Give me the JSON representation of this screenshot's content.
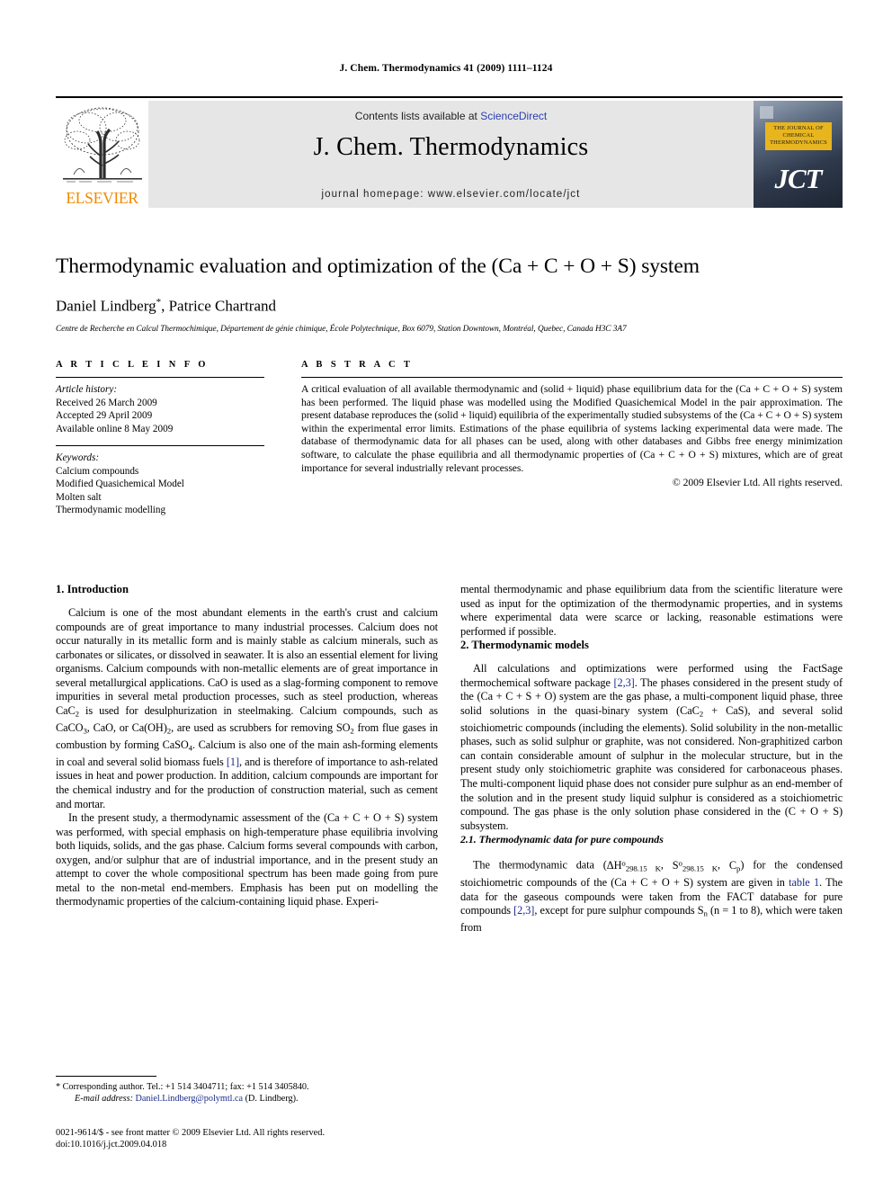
{
  "running_head": "J. Chem. Thermodynamics 41 (2009) 1111–1124",
  "masthead": {
    "publisher_name": "ELSEVIER",
    "contents_prefix": "Contents lists available at ",
    "contents_link": "ScienceDirect",
    "journal_title": "J. Chem. Thermodynamics",
    "homepage": "journal homepage: www.elsevier.com/locate/jct",
    "cover_title": "THE JOURNAL OF CHEMICAL THERMODYNAMICS",
    "cover_abbrev": "JCT"
  },
  "article": {
    "title": "Thermodynamic evaluation and optimization of the (Ca + C + O + S) system",
    "authors": "Daniel Lindberg",
    "authors_rest": ", Patrice Chartrand",
    "corresponding_marker": "*",
    "affiliation": "Centre de Recherche en Calcul Thermochimique, Département de génie chimique, École Polytechnique, Box 6079, Station Downtown, Montréal, Quebec, Canada H3C 3A7"
  },
  "info": {
    "heading": "A R T I C L E   I N F O",
    "history_label": "Article history:",
    "history": [
      "Received 26 March 2009",
      "Accepted 29 April 2009",
      "Available online 8 May 2009"
    ],
    "keywords_label": "Keywords:",
    "keywords": [
      "Calcium compounds",
      "Modified Quasichemical Model",
      "Molten salt",
      "Thermodynamic modelling"
    ]
  },
  "abstract": {
    "heading": "A B S T R A C T",
    "text": "A critical evaluation of all available thermodynamic and (solid + liquid) phase equilibrium data for the (Ca + C + O + S) system has been performed. The liquid phase was modelled using the Modified Quasichemical Model in the pair approximation. The present database reproduces the (solid + liquid) equilibria of the experimentally studied subsystems of the (Ca + C + O + S) system within the experimental error limits. Estimations of the phase equilibria of systems lacking experimental data were made. The database of thermodynamic data for all phases can be used, along with other databases and Gibbs free energy minimization software, to calculate the phase equilibria and all thermodynamic properties of (Ca + C + O + S) mixtures, which are of great importance for several industrially relevant processes.",
    "copyright": "© 2009 Elsevier Ltd. All rights reserved."
  },
  "sections": {
    "intro_heading": "1. Introduction",
    "intro_p1_a": "Calcium is one of the most abundant elements in the earth's crust and calcium compounds are of great importance to many industrial processes. Calcium does not occur naturally in its metallic form and is mainly stable as calcium minerals, such as carbonates or silicates, or dissolved in seawater. It is also an essential element for living organisms. Calcium compounds with non-metallic elements are of great importance in several metallurgical applications. CaO is used as a slag-forming component to remove impurities in several metal production processes, such as steel production, whereas CaC",
    "intro_p1_b": " is used for desulphurization in steelmaking. Calcium compounds, such as CaCO",
    "intro_p1_c": ", CaO, or Ca(OH)",
    "intro_p1_d": ", are used as scrubbers for removing SO",
    "intro_p1_e": " from flue gases in combustion by forming CaSO",
    "intro_p1_f": ". Calcium is also one of the main ash-forming elements in coal and several solid biomass fuels ",
    "intro_p1_ref": "[1]",
    "intro_p1_g": ", and is therefore of importance to ash-related issues in heat and power production. In addition, calcium compounds are important for the chemical industry and for the production of construction material, such as cement and mortar.",
    "intro_p2": "In the present study, a thermodynamic assessment of the (Ca + C + O + S) system was performed, with special emphasis on high-temperature phase equilibria involving both liquids, solids, and the gas phase. Calcium forms several compounds with carbon, oxygen, and/or sulphur that are of industrial importance, and in the present study an attempt to cover the whole compositional spectrum has been made going from pure metal to the non-metal end-members. Emphasis has been put on modelling the thermodynamic properties of the calcium-containing liquid phase. Experi-",
    "intro_p2_cont": "mental thermodynamic and phase equilibrium data from the scientific literature were used as input for the optimization of the thermodynamic properties, and in systems where experimental data were scarce or lacking, reasonable estimations were performed if possible.",
    "models_heading": "2. Thermodynamic models",
    "models_p1_a": "All calculations and optimizations were performed using the FactSage thermochemical software package ",
    "models_p1_ref": "[2,3]",
    "models_p1_b": ". The phases considered in the present study of the (Ca + C + S + O) system are the gas phase, a multi-component liquid phase, three solid solutions in the quasi-binary system (CaC",
    "models_p1_c": " + CaS), and several solid stoichiometric compounds (including the elements). Solid solubility in the non-metallic phases, such as solid sulphur or graphite, was not considered. Non-graphitized carbon can contain considerable amount of sulphur in the molecular structure, but in the present study only stoichiometric graphite was considered for carbonaceous phases. The multi-component liquid phase does not consider pure sulphur as an end-member of the solution and in the present study liquid sulphur is considered as a stoichiometric compound. The gas phase is the only solution phase considered in the (C + O + S) subsystem.",
    "pure_heading": "2.1. Thermodynamic data for pure compounds",
    "pure_p1_a": "The thermodynamic data (",
    "pure_sym_dh": "ΔH",
    "pure_sym_dh_sup": "o",
    "pure_sym_dh_sub": "298.15 K",
    "pure_sym_s": "S",
    "pure_sym_s_sup": "o",
    "pure_sym_s_sub": "298.15 K",
    "pure_sym_cp": "C",
    "pure_sym_cp_sub": "p",
    "pure_p1_b": ") for the condensed stoichiometric compounds of the (Ca + C + O + S) system are given in ",
    "pure_table_link": "table 1",
    "pure_p1_c": ". The data for the gaseous compounds were taken from the FACT database for pure compounds ",
    "pure_p1_ref": "[2,3]",
    "pure_p1_d": ", except for pure sulphur compounds S",
    "pure_p1_sub": "n",
    "pure_p1_e": " (n = 1 to 8), which were taken from"
  },
  "footnote": {
    "marker": "*",
    "corresponding": "Corresponding author. Tel.: +1 514 3404711; fax: +1 514 3405840.",
    "email_label": "E-mail address:",
    "email": "Daniel.Lindberg@polymtl.ca",
    "email_owner": "(D. Lindberg)."
  },
  "footer": {
    "issn_line": "0021-9614/$ - see front matter © 2009 Elsevier Ltd. All rights reserved.",
    "doi_line": "doi:10.1016/j.jct.2009.04.018"
  },
  "colors": {
    "elsevier_orange": "#F08A00",
    "link_blue": "#1b2a8a",
    "sciencedirect_blue": "#2a3fb0",
    "panel_gray": "#e6e6e6",
    "cover_gold": "#e8b51e"
  }
}
